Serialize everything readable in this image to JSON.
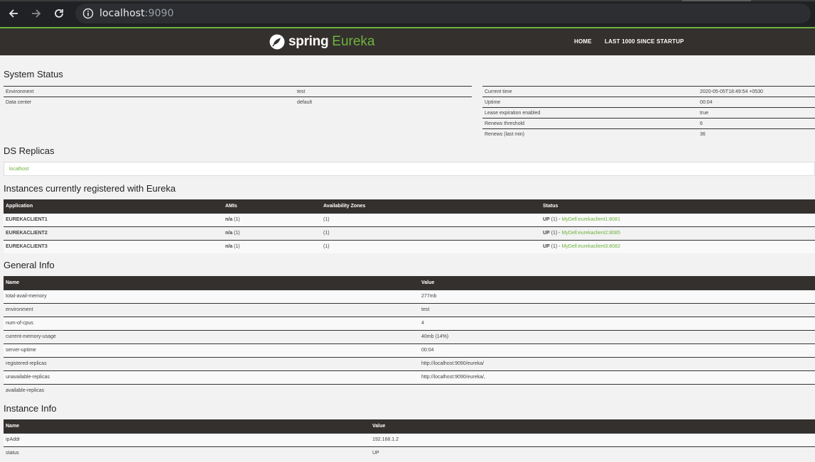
{
  "browser": {
    "url_host": "localhost",
    "url_port": ":9090",
    "back_label": "Back",
    "forward_label": "Forward",
    "reload_label": "Reload"
  },
  "navbar": {
    "brand_spring": "spring",
    "brand_eureka": "Eureka",
    "home": "HOME",
    "last1000": "LAST 1000 SINCE STARTUP"
  },
  "system_status": {
    "title": "System Status",
    "left": [
      {
        "key": "Environment",
        "value": "test"
      },
      {
        "key": "Data center",
        "value": "default"
      }
    ],
    "right": [
      {
        "key": "Current time",
        "value": "2020-05-05T18:49:54 +0530"
      },
      {
        "key": "Uptime",
        "value": "00:04"
      },
      {
        "key": "Lease expiration enabled",
        "value": "true"
      },
      {
        "key": "Renews threshold",
        "value": "6"
      },
      {
        "key": "Renews (last min)",
        "value": "36"
      }
    ]
  },
  "ds_replicas": {
    "title": "DS Replicas",
    "items": [
      "localhost"
    ]
  },
  "instances": {
    "title": "Instances currently registered with Eureka",
    "headers": [
      "Application",
      "AMIs",
      "Availability Zones",
      "Status"
    ],
    "rows": [
      {
        "app": "EUREKACLIENT1",
        "ami_bold": "n/a",
        "ami_count": " (1)",
        "zones": "(1)",
        "status_bold": "UP",
        "status_count": " (1) - ",
        "status_link": "MyDell:eurekaclient1:8081"
      },
      {
        "app": "EUREKACLIENT2",
        "ami_bold": "n/a",
        "ami_count": " (1)",
        "zones": "(1)",
        "status_bold": "UP",
        "status_count": " (1) - ",
        "status_link": "MyDell:eurekaclient2:8085"
      },
      {
        "app": "EUREKACLIENT3",
        "ami_bold": "n/a",
        "ami_count": " (1)",
        "zones": "(1)",
        "status_bold": "UP",
        "status_count": " (1) - ",
        "status_link": "MyDell:eurekaclient3:8082"
      }
    ]
  },
  "general_info": {
    "title": "General Info",
    "headers": [
      "Name",
      "Value"
    ],
    "rows": [
      {
        "name": "total-avail-memory",
        "value": "277mb"
      },
      {
        "name": "environment",
        "value": "test"
      },
      {
        "name": "num-of-cpus",
        "value": "4"
      },
      {
        "name": "current-memory-usage",
        "value": "40mb (14%)"
      },
      {
        "name": "server-uptime",
        "value": "00:04"
      },
      {
        "name": "registered-replicas",
        "value": "http://localhost:9090/eureka/"
      },
      {
        "name": "unavailable-replicas",
        "value": "http://localhost:9090/eureka/,"
      },
      {
        "name": "available-replicas",
        "value": ""
      }
    ]
  },
  "instance_info": {
    "title": "Instance Info",
    "headers": [
      "Name",
      "Value"
    ],
    "rows": [
      {
        "name": "ipAddr",
        "value": "192.168.1.2"
      },
      {
        "name": "status",
        "value": "UP"
      }
    ]
  },
  "colors": {
    "brand_green": "#6db33f",
    "navbar_bg": "#34302d",
    "page_bg": "#f2f2f2"
  }
}
